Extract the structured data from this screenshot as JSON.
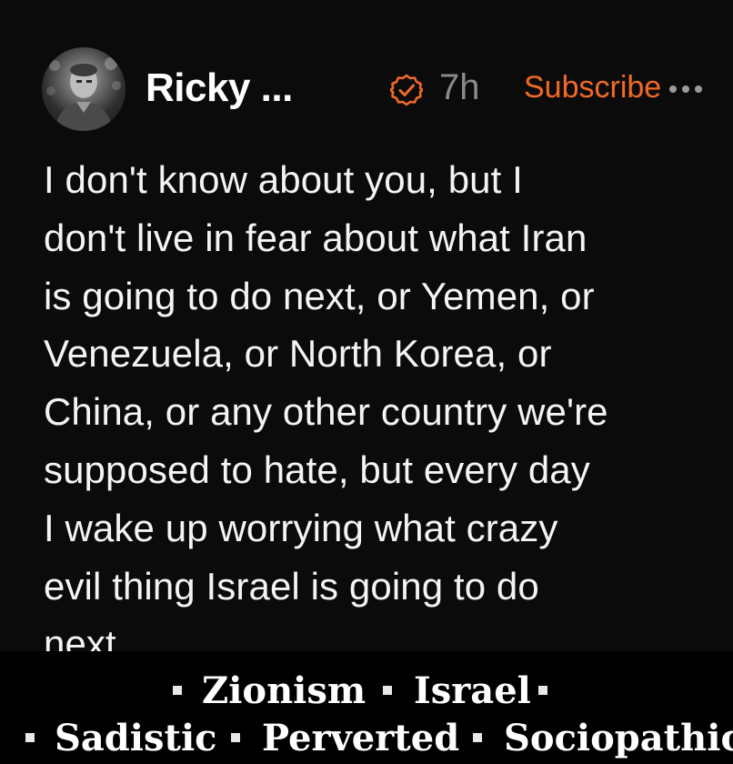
{
  "post": {
    "author_name": "Ricky ...",
    "timestamp": "7h",
    "subscribe_label": "Subscribe",
    "verified_icon": "verified-check-icon",
    "more_icon": "more-horizontal-icon",
    "accent_color": "#f06a25",
    "body": "I don't know about you, but I\ndon't live in fear about what Iran\nis going to do next, or Yemen, or\nVenezuela, or North Korea, or\nChina, or any other country we're\nsupposed to hate, but every day\nI wake up worrying what crazy\nevil thing Israel is going to do\nnext."
  },
  "tags": {
    "row1": [
      "Zionism",
      "Israel"
    ],
    "row2": [
      "Sadistic",
      "Perverted",
      "Sociopathic"
    ]
  }
}
